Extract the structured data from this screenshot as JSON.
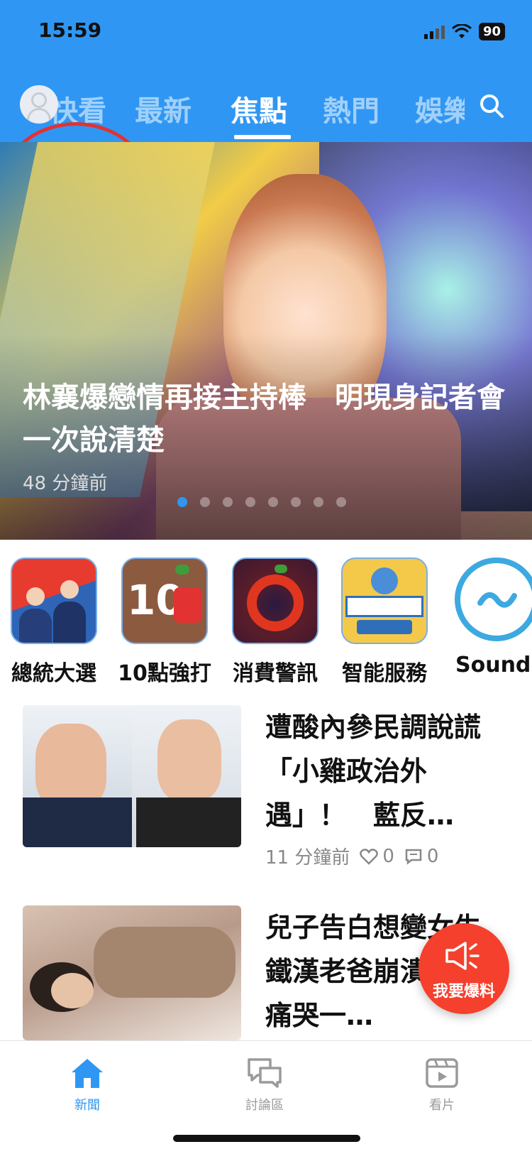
{
  "status_bar": {
    "time": "15:59",
    "battery": "90"
  },
  "tabs": [
    {
      "label": "快看"
    },
    {
      "label": "最新"
    },
    {
      "label": "焦點"
    },
    {
      "label": "熱門"
    },
    {
      "label": "娛樂"
    }
  ],
  "active_tab": "焦點",
  "hero": {
    "title": "林襄爆戀情再接主持棒　明現身記者會一次說清楚",
    "time": "48 分鐘前",
    "slide_count": 8,
    "active_slide": 1
  },
  "shortcuts": [
    {
      "label": "總統大選",
      "icon": "election-icon"
    },
    {
      "label": "10點強打",
      "icon": "ten-pm-icon"
    },
    {
      "label": "消費警訊",
      "icon": "consumer-alert-icon"
    },
    {
      "label": "智能服務",
      "icon": "smart-service-icon"
    },
    {
      "label": "Sound",
      "icon": "sound-icon"
    }
  ],
  "news": [
    {
      "title": "遭酸內參民調說謊「小雞政治外遇」！　藍反…",
      "time": "11 分鐘前",
      "likes": "0",
      "comments": "0"
    },
    {
      "title": "兒子告白想變女生　鐵漢老爸崩潰了！痛哭一…"
    }
  ],
  "fab": {
    "label": "我要爆料"
  },
  "bottom_nav": [
    {
      "label": "新聞"
    },
    {
      "label": "討論區"
    },
    {
      "label": "看片"
    }
  ],
  "colors": {
    "brand_blue": "#2f97f3",
    "fab_red": "#f4402c",
    "annotation_red": "#e23232"
  }
}
